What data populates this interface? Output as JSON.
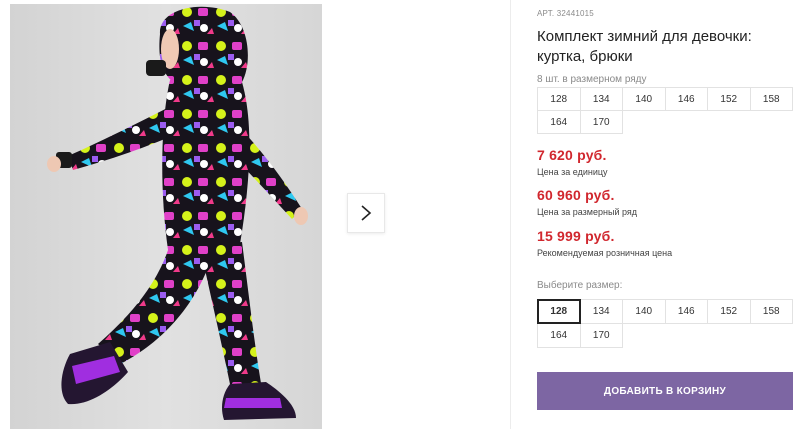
{
  "product": {
    "article": "АРТ. 32441015",
    "title": "Комплект зимний для девочки: куртка, брюки"
  },
  "gallery": {
    "image_alt": "Девочка в зимнем комплекте с ярким принтом",
    "next_icon": "chevron-right-icon"
  },
  "size_row": {
    "hint": "8 шт. в размерном ряду",
    "sizes": [
      "128",
      "134",
      "140",
      "146",
      "152",
      "158",
      "164",
      "170"
    ]
  },
  "prices": {
    "unit": {
      "value": "7 620 руб.",
      "label": "Цена за единицу"
    },
    "row": {
      "value": "60 960 руб.",
      "label": "Цена за размерный ряд"
    },
    "retail": {
      "value": "15 999 руб.",
      "label": "Рекомендуемая розничная цена"
    }
  },
  "size_select": {
    "hint": "Выберите размер:",
    "sizes": [
      "128",
      "134",
      "140",
      "146",
      "152",
      "158",
      "164",
      "170"
    ],
    "selected": "128"
  },
  "cart_button": {
    "label": "ДОБАВИТЬ В КОРЗИНУ"
  },
  "colors": {
    "price": "#d1272e",
    "button": "#7d66a3"
  }
}
